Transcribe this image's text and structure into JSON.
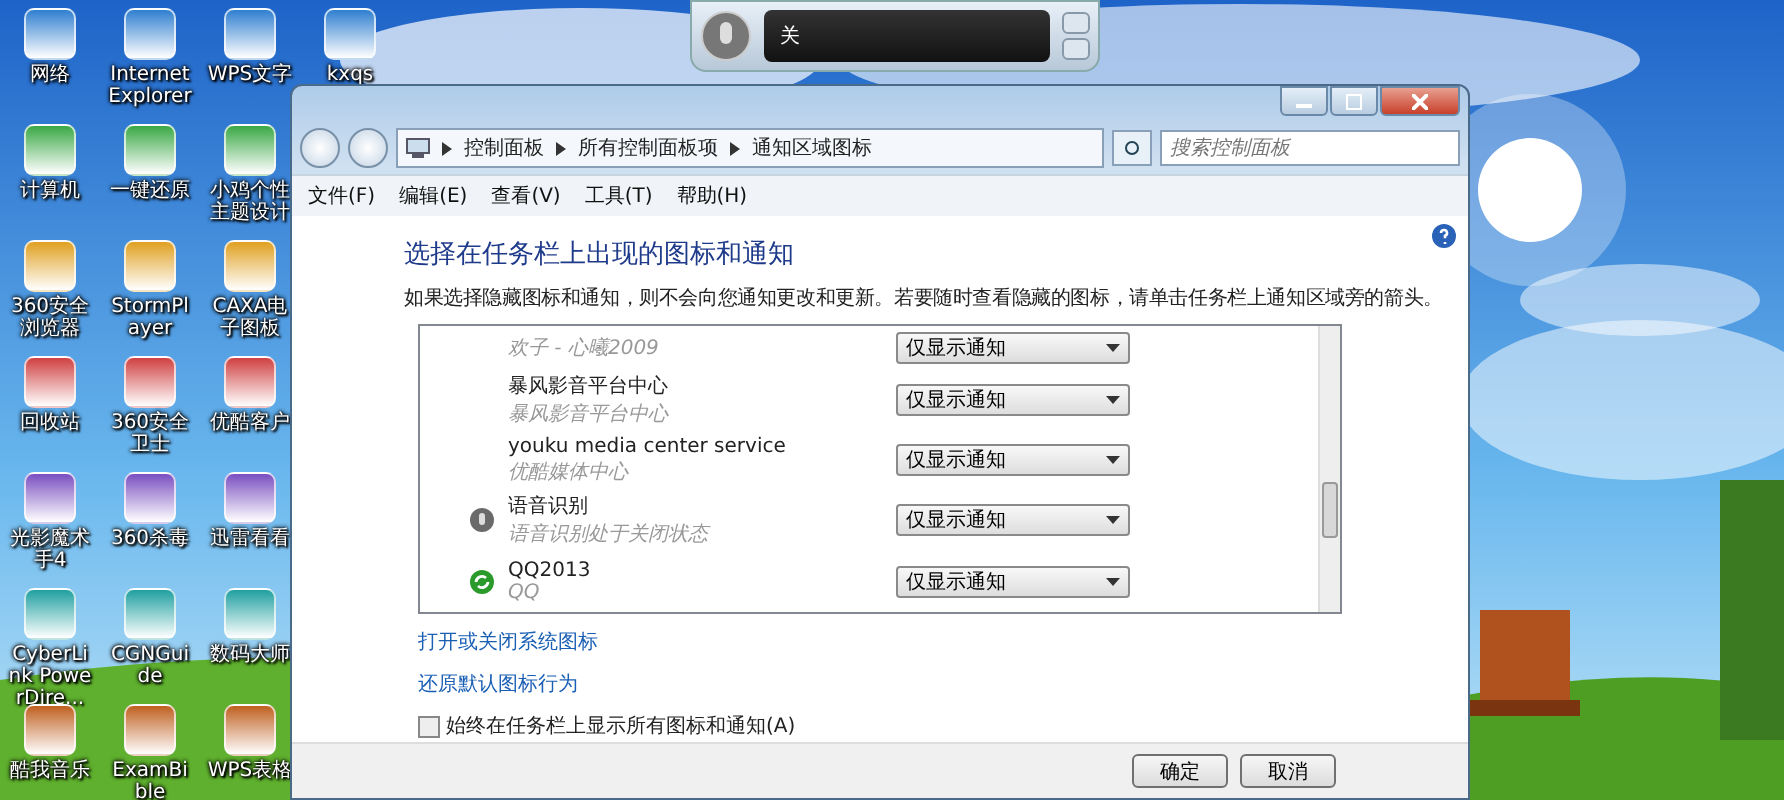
{
  "desktop_icon_columns": [
    [
      {
        "label": "网络"
      },
      {
        "label": "计算机"
      },
      {
        "label": "360安全浏览器"
      },
      {
        "label": "回收站"
      },
      {
        "label": "光影魔术手4"
      },
      {
        "label": "CyberLink PowerDire..."
      },
      {
        "label": "酷我音乐"
      }
    ],
    [
      {
        "label": "Internet Explorer"
      },
      {
        "label": "一键还原"
      },
      {
        "label": "StormPlayer"
      },
      {
        "label": "360安全卫士"
      },
      {
        "label": "360杀毒"
      },
      {
        "label": "CGNGuide"
      },
      {
        "label": "ExamBible"
      }
    ],
    [
      {
        "label": "WPS文字"
      },
      {
        "label": "小鸡个性主题设计"
      },
      {
        "label": "CAXA电子图板"
      },
      {
        "label": "优酷客户"
      },
      {
        "label": "迅雷看看"
      },
      {
        "label": "数码大师"
      },
      {
        "label": "WPS表格"
      }
    ],
    [
      {
        "label": "kxqs"
      }
    ]
  ],
  "speech_widget": {
    "status": "关"
  },
  "window": {
    "breadcrumb": [
      "控制面板",
      "所有控制面板项",
      "通知区域图标"
    ],
    "search": {
      "placeholder": "搜索控制面板"
    },
    "menu": [
      "文件(F)",
      "编辑(E)",
      "查看(V)",
      "工具(T)",
      "帮助(H)"
    ],
    "heading": "选择在任务栏上出现的图标和通知",
    "description": "如果选择隐藏图标和通知，则不会向您通知更改和更新。若要随时查看隐藏的图标，请单击任务栏上通知区域旁的箭头。",
    "icon_rows": [
      {
        "kind": "cut",
        "subtitle": "欢子 - 心曦2009",
        "behavior": "仅显示通知"
      },
      {
        "kind": "plain",
        "name": "暴风影音平台中心",
        "subtitle": "暴风影音平台中心",
        "behavior": "仅显示通知"
      },
      {
        "kind": "plain",
        "name": "youku media center service",
        "subtitle": "优酷媒体中心",
        "behavior": "仅显示通知"
      },
      {
        "kind": "speech",
        "name": "语音识别",
        "subtitle": "语音识别处于关闭状态",
        "behavior": "仅显示通知"
      },
      {
        "kind": "qq",
        "name": "QQ2013",
        "subtitle": "QQ",
        "behavior": "仅显示通知"
      }
    ],
    "links": [
      "打开或关闭系统图标",
      "还原默认图标行为"
    ],
    "always_show": {
      "label": "始终在任务栏上显示所有图标和通知(A)",
      "checked": false
    },
    "buttons": [
      "确定",
      "取消"
    ]
  }
}
